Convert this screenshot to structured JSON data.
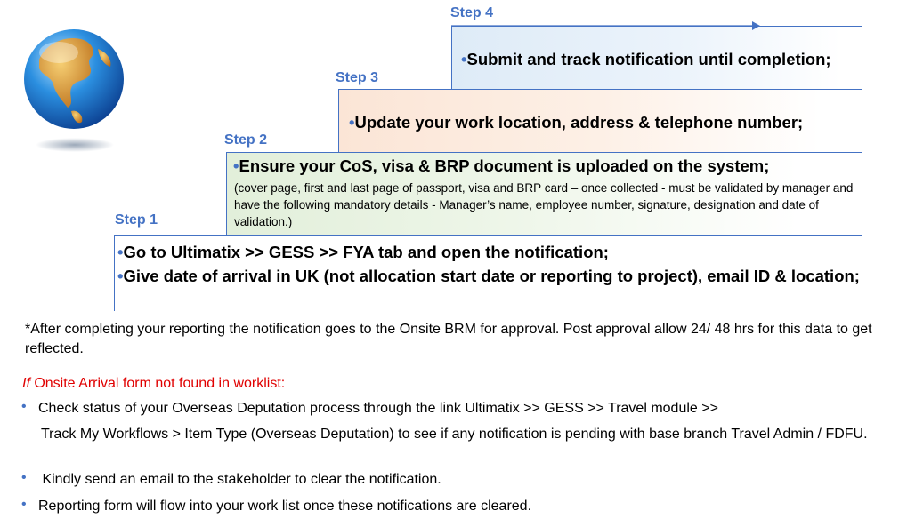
{
  "steps": [
    {
      "label": "Step 1",
      "bullets": [
        "Go to Ultimatix >> GESS >> FYA tab and open the notification;",
        "Give date of arrival in UK  (not allocation start date or reporting to project), email ID & location;"
      ]
    },
    {
      "label": "Step 2",
      "bullets": [
        "Ensure your CoS, visa & BRP document is uploaded on the system;"
      ],
      "detail": "(cover page, first and last page of passport, visa and BRP card – once collected -  must be validated by manager and have the following mandatory details - Manager’s name, employee number, signature, designation and date of validation.)"
    },
    {
      "label": "Step 3",
      "bullets": [
        "Update your work location,  address & telephone number;"
      ]
    },
    {
      "label": "Step 4",
      "bullets": [
        "Submit and track notification until completion;"
      ]
    }
  ],
  "note": "*After completing your reporting the notification goes to the Onsite BRM for approval. Post approval allow 24/ 48 hrs for this data to get reflected.",
  "fallback": {
    "heading_if": "If",
    "heading_rest": " Onsite Arrival form not found in worklist:",
    "items": [
      "Check status of your Overseas Deputation process through the link Ultimatix  >> GESS >> Travel module >>",
      "Track My Workflows > Item Type (Overseas Deputation) to see if any notification is pending with base branch Travel Admin / FDFU.",
      " Kindly send an email to the stakeholder to clear the notification.",
      "Reporting form will flow into your work list once these notifications are cleared."
    ]
  },
  "colors": {
    "accent": "#4472c4",
    "step2_fill": "#e2efda",
    "step3_fill": "#fbe5d6",
    "step4_fill": "#deebf7",
    "heading_red": "#e00000"
  },
  "icons": [
    "globe-icon",
    "arrow-right-icon"
  ]
}
